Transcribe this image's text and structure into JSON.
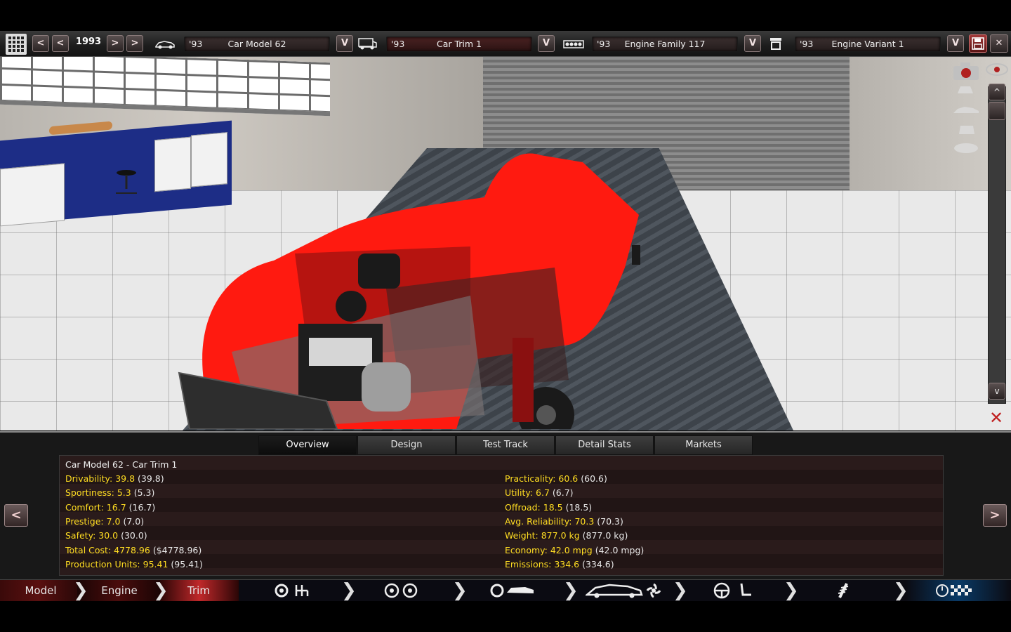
{
  "toolbar": {
    "year": "1993",
    "model": {
      "year": "'93",
      "name": "Car Model 62"
    },
    "trim": {
      "year": "'93",
      "name": "Car Trim 1"
    },
    "engine_family": {
      "year": "'93",
      "name": "Engine Family 117"
    },
    "engine_variant": {
      "year": "'93",
      "name": "Engine Variant 1"
    },
    "prev_label": "<",
    "next_label": ">",
    "dropdown_label": "V",
    "close_label": "✕"
  },
  "tabs": [
    "Overview",
    "Design",
    "Test Track",
    "Detail Stats",
    "Markets"
  ],
  "active_tab": "Overview",
  "stats": {
    "title": "Car Model 62 - Car Trim 1",
    "left": [
      {
        "key": "Drivability: 39.8",
        "paren": "(39.8)"
      },
      {
        "key": "Sportiness: 5.3",
        "paren": "(5.3)"
      },
      {
        "key": "Comfort: 16.7",
        "paren": "(16.7)"
      },
      {
        "key": "Prestige: 7.0",
        "paren": "(7.0)"
      },
      {
        "key": "Safety: 30.0",
        "paren": "(30.0)"
      },
      {
        "key": "Total Cost: 4778.96",
        "paren": "($4778.96)"
      },
      {
        "key": "Production Units: 95.41",
        "paren": "(95.41)"
      }
    ],
    "right": [
      {
        "key": "Practicality: 60.6",
        "paren": "(60.6)"
      },
      {
        "key": "Utility: 6.7",
        "paren": "(6.7)"
      },
      {
        "key": "Offroad: 18.5",
        "paren": "(18.5)"
      },
      {
        "key": "Avg. Reliability: 70.3",
        "paren": "(70.3)"
      },
      {
        "key": "Weight: 877.0 kg",
        "paren": "(877.0 kg)"
      },
      {
        "key": "Economy: 42.0 mpg",
        "paren": "(42.0 mpg)"
      },
      {
        "key": "Emissions: 334.6",
        "paren": "(334.6)"
      }
    ]
  },
  "panel_nav": {
    "prev": "<",
    "next": ">"
  },
  "nav": {
    "model": "Model",
    "engine": "Engine",
    "trim": "Trim",
    "chevron": "❯",
    "icons": [
      "gearbox-icon",
      "wheels-icon",
      "body-icon",
      "aero-icon",
      "interior-icon",
      "suspension-icon",
      "test-icon"
    ]
  },
  "colors": {
    "accent_red": "#c0282a",
    "stat_yellow": "#ffdd22",
    "car_red": "#ff1a10"
  }
}
